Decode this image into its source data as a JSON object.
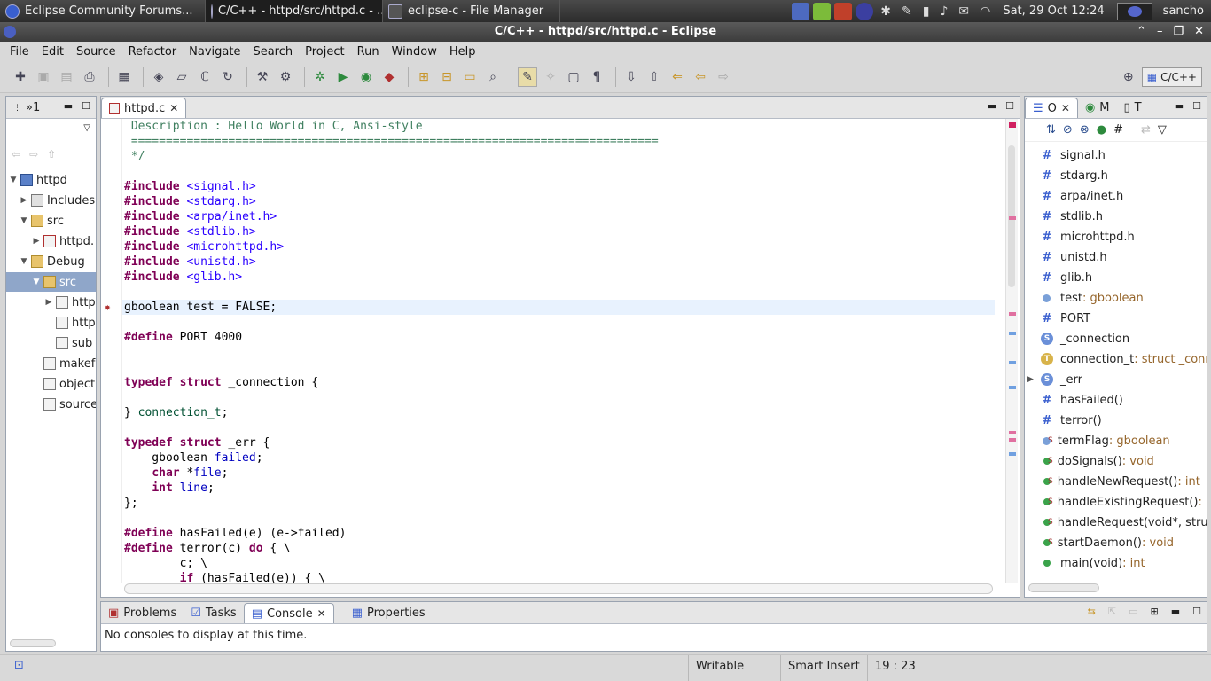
{
  "taskbar": {
    "tasks": [
      {
        "label": "Eclipse Community Forums..."
      },
      {
        "label": "C/C++ - httpd/src/httpd.c - ..."
      },
      {
        "label": "eclipse-c - File Manager"
      }
    ],
    "clock": "Sat, 29 Oct  12:24",
    "user": "sancho"
  },
  "window": {
    "title": "C/C++ - httpd/src/httpd.c - Eclipse"
  },
  "menubar": {
    "items": [
      "File",
      "Edit",
      "Source",
      "Refactor",
      "Navigate",
      "Search",
      "Project",
      "Run",
      "Window",
      "Help"
    ]
  },
  "toolbar": {
    "perspective_label": "C/C++"
  },
  "project_explorer": {
    "tab_label": "»1",
    "tree": [
      {
        "label": "httpd"
      },
      {
        "label": "Includes"
      },
      {
        "label": "src"
      },
      {
        "label": "httpd."
      },
      {
        "label": "Debug"
      },
      {
        "label": "src"
      },
      {
        "label": "http"
      },
      {
        "label": "http"
      },
      {
        "label": "sub"
      },
      {
        "label": "makef"
      },
      {
        "label": "object"
      },
      {
        "label": "source"
      }
    ]
  },
  "editor": {
    "tab_label": "httpd.c",
    "lines": [
      " Description : Hello World in C, Ansi-style",
      " ============================================================================",
      " */",
      "",
      "#include <signal.h>",
      "#include <stdarg.h>",
      "#include <arpa/inet.h>",
      "#include <stdlib.h>",
      "#include <microhttpd.h>",
      "#include <unistd.h>",
      "#include <glib.h>",
      "",
      "gboolean test = FALSE;",
      "",
      "#define PORT 4000",
      "",
      "",
      "typedef struct _connection {",
      "",
      "} connection_t;",
      "",
      "typedef struct _err {",
      "    gboolean failed;",
      "    char *file;",
      "    int line;",
      "};",
      "",
      "#define hasFailed(e) (e->failed)",
      "#define terror(c) do { \\",
      "        c; \\",
      "        if (hasFailed(e)) { \\"
    ]
  },
  "outline": {
    "tabs": [
      "O",
      "M",
      "T"
    ],
    "items": [
      {
        "name": "signal.h",
        "type": ""
      },
      {
        "name": "stdarg.h",
        "type": ""
      },
      {
        "name": "arpa/inet.h",
        "type": ""
      },
      {
        "name": "stdlib.h",
        "type": ""
      },
      {
        "name": "microhttpd.h",
        "type": ""
      },
      {
        "name": "unistd.h",
        "type": ""
      },
      {
        "name": "glib.h",
        "type": ""
      },
      {
        "name": "test",
        "type": " : gboolean"
      },
      {
        "name": "PORT",
        "type": ""
      },
      {
        "name": "_connection",
        "type": ""
      },
      {
        "name": "connection_t",
        "type": " : struct _conn"
      },
      {
        "name": "_err",
        "type": ""
      },
      {
        "name": "hasFailed()",
        "type": ""
      },
      {
        "name": "terror()",
        "type": ""
      },
      {
        "name": "termFlag",
        "type": " : gboolean"
      },
      {
        "name": "doSignals()",
        "type": " : void"
      },
      {
        "name": "handleNewRequest()",
        "type": " : int"
      },
      {
        "name": "handleExistingRequest()",
        "type": " : in"
      },
      {
        "name": "handleRequest(void*, struc",
        "type": ""
      },
      {
        "name": "startDaemon()",
        "type": " : void"
      },
      {
        "name": "main(void)",
        "type": " : int"
      }
    ]
  },
  "console": {
    "tabs": [
      "Problems",
      "Tasks",
      "Console",
      "Properties"
    ],
    "message": "No consoles to display at this time."
  },
  "statusbar": {
    "writable": "Writable",
    "insert_mode": "Smart Insert",
    "position": "19 : 23"
  }
}
